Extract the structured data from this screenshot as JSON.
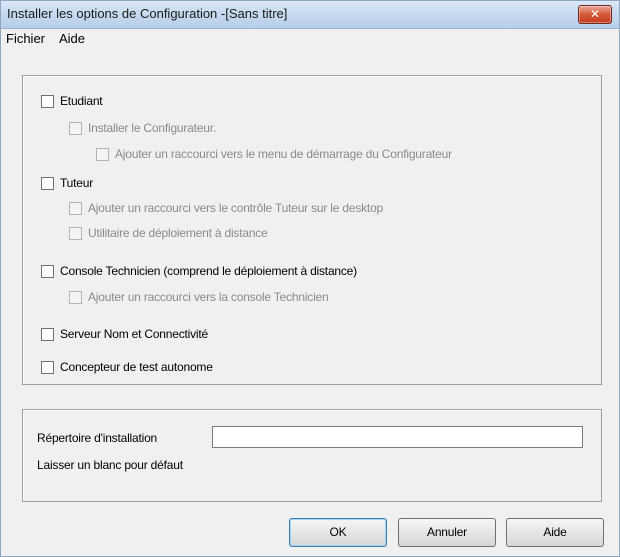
{
  "window": {
    "title": "Installer les options de Configuration -[Sans titre]",
    "close_glyph": "✕"
  },
  "menu": {
    "items": [
      "Fichier",
      "Aide"
    ]
  },
  "options": {
    "etudiant": "Etudiant",
    "installer_configurateur": "Installer le Configurateur.",
    "raccourci_configurateur": "Ajouter un raccourci vers le menu de démarrage du Configurateur",
    "tuteur": "Tuteur",
    "raccourci_tuteur": "Ajouter un raccourci vers le contrôle Tuteur sur le desktop",
    "utilitaire_deploiement": "Utilitaire de déploiement à distance",
    "console_technicien": "Console Technicien (comprend le déploiement à distance)",
    "raccourci_console": "Ajouter un raccourci vers la console Technicien",
    "serveur_nom": "Serveur Nom et Connectivité",
    "concepteur_test": "Concepteur de test autonome"
  },
  "install_dir": {
    "label": "Répertoire d'installation",
    "value": "",
    "hint": "Laisser un blanc pour défaut"
  },
  "buttons": {
    "ok": "OK",
    "cancel": "Annuler",
    "help": "Aide"
  }
}
